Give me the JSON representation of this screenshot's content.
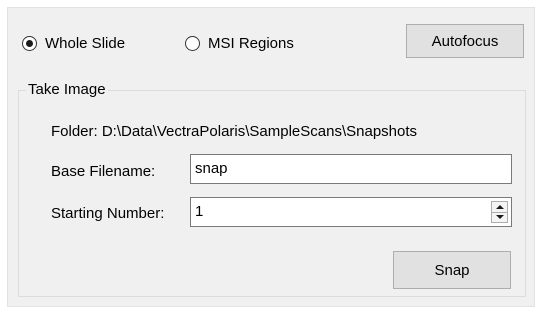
{
  "mode": {
    "whole_slide_label": "Whole Slide",
    "whole_slide_selected": true,
    "msi_regions_label": "MSI Regions",
    "msi_regions_selected": false
  },
  "autofocus_label": "Autofocus",
  "take_image": {
    "group_title": "Take Image",
    "folder_text": "Folder: D:\\Data\\VectraPolaris\\SampleScans\\Snapshots",
    "base_filename_label": "Base Filename:",
    "base_filename_value": "snap",
    "starting_number_label": "Starting Number:",
    "starting_number_value": "1",
    "snap_label": "Snap"
  },
  "icons": {
    "spinner_up": "spinner-up-arrow-icon",
    "spinner_down": "spinner-down-arrow-icon"
  }
}
